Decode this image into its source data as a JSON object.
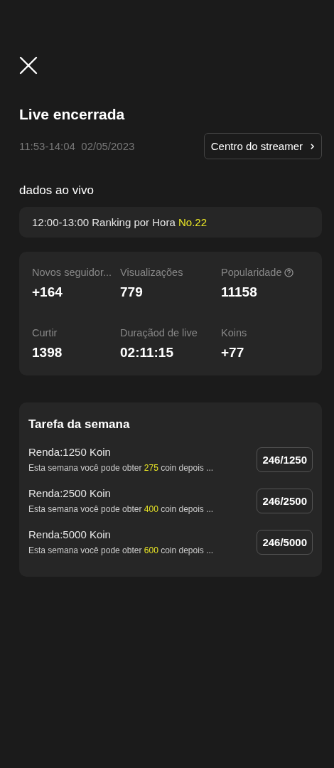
{
  "title": "Live encerrada",
  "time_range": "11:53-14:04",
  "date": "02/05/2023",
  "streamer_button": {
    "label": "Centro do streamer"
  },
  "live_data": {
    "heading": "dados ao vivo",
    "ranking": {
      "text": "12:00-13:00 Ranking por Hora",
      "highlight": "No.22"
    },
    "stats": [
      {
        "label": "Novos seguidor...",
        "value": "+164",
        "help_icon": false
      },
      {
        "label": "Visualizações",
        "value": "779",
        "help_icon": false
      },
      {
        "label": "Popularidade",
        "value": "11158",
        "help_icon": true
      },
      {
        "label": "Curtir",
        "value": "1398",
        "help_icon": false
      },
      {
        "label": "Duraçãod de live",
        "value": "02:11:15",
        "help_icon": false
      },
      {
        "label": "Koins",
        "value": "+77",
        "help_icon": false
      }
    ]
  },
  "weekly_tasks": {
    "heading": "Tarefa da semana",
    "tasks": [
      {
        "title": "Renda:1250 Koin",
        "text_before": "Esta semana você pode obter",
        "highlight": "275",
        "text_after": "coin depois ...",
        "progress": "246/1250"
      },
      {
        "title": "Renda:2500 Koin",
        "text_before": "Esta semana você pode obter",
        "highlight": "400",
        "text_after": "coin depois ...",
        "progress": "246/2500"
      },
      {
        "title": "Renda:5000 Koin",
        "text_before": "Esta semana você pode obter",
        "highlight": "600",
        "text_after": "coin depois ...",
        "progress": "246/5000"
      }
    ]
  }
}
